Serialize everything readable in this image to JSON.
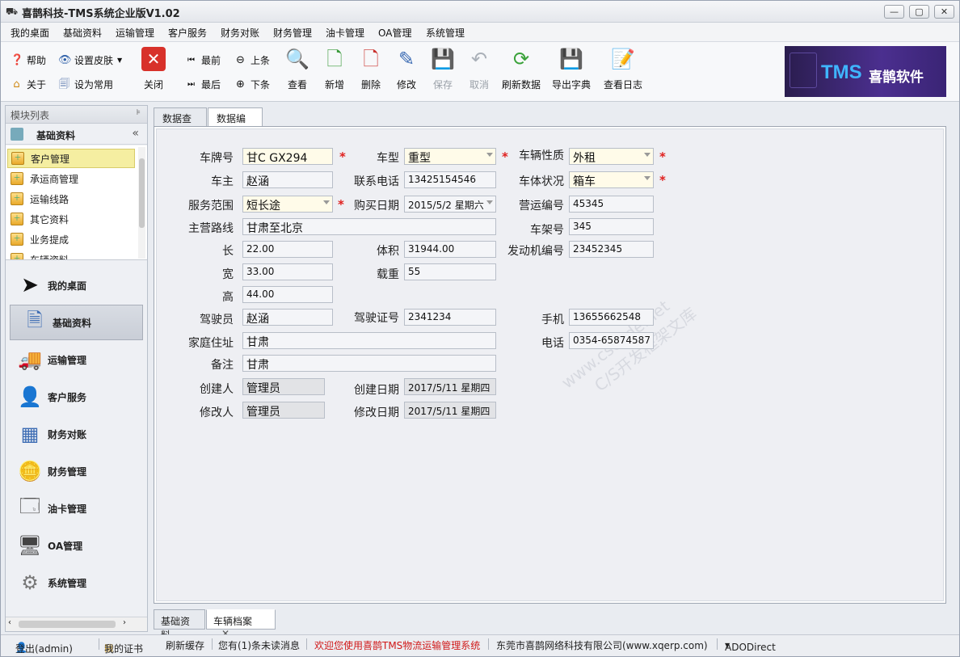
{
  "window": {
    "title": "喜鹊科技-TMS系统企业版V1.02"
  },
  "menu": [
    "我的桌面",
    "基础资料",
    "运输管理",
    "客户服务",
    "财务对账",
    "财务管理",
    "油卡管理",
    "OA管理",
    "系统管理"
  ],
  "toolbar": {
    "help": "帮助",
    "skin": "设置皮肤",
    "about": "关于",
    "set_common": "设为常用",
    "close": "关闭",
    "first": "最前",
    "last": "最后",
    "prev": "上条",
    "next": "下条",
    "view": "查看",
    "add": "新增",
    "delete": "删除",
    "edit": "修改",
    "save": "保存",
    "cancel": "取消",
    "refresh": "刷新数据",
    "export": "导出字典",
    "log": "查看日志"
  },
  "banner": {
    "tms": "TMS",
    "company": "喜鹊软件"
  },
  "sidebar": {
    "header": "模块列表",
    "group": "基础资料",
    "tree": [
      "客户管理",
      "承运商管理",
      "运输线路",
      "其它资料",
      "业务提成",
      "车辆资料"
    ],
    "nav": [
      "我的桌面",
      "基础资料",
      "运输管理",
      "客户服务",
      "财务对账",
      "财务管理",
      "油卡管理",
      "OA管理",
      "系统管理"
    ]
  },
  "tabs": {
    "query": "数据查询",
    "edit": "数据编辑"
  },
  "form": {
    "plate_label": "车牌号",
    "plate": "甘C GX294",
    "type_label": "车型",
    "type": "重型",
    "nature_label": "车辆性质",
    "nature": "外租",
    "owner_label": "车主",
    "owner": "赵涵",
    "phone_label": "联系电话",
    "phone": "13425154546",
    "body_label": "车体状况",
    "body": "箱车",
    "scope_label": "服务范围",
    "scope": "短长途",
    "buy_label": "购买日期",
    "buy": "2015/5/2 星期六",
    "opno_label": "营运编号",
    "opno": "45345",
    "route_label": "主营路线",
    "route": "甘肃至北京",
    "frame_label": "车架号",
    "frame": "345",
    "len_label": "长",
    "len": "22.00",
    "vol_label": "体积",
    "vol": "31944.00",
    "engine_label": "发动机编号",
    "engine": "23452345",
    "wid_label": "宽",
    "wid": "33.00",
    "load_label": "载重",
    "load": "55",
    "hei_label": "高",
    "hei": "44.00",
    "driver_label": "驾驶员",
    "driver": "赵涵",
    "license_label": "驾驶证号",
    "license": "2341234",
    "mobile_label": "手机",
    "mobile": "13655662548",
    "address_label": "家庭住址",
    "address": "甘肃",
    "tel_label": "电话",
    "tel": "0354-65874587",
    "note_label": "备注",
    "note": "甘肃",
    "creator_label": "创建人",
    "creator": "管理员",
    "cdate_label": "创建日期",
    "cdate": "2017/5/11 星期四",
    "modifier_label": "修改人",
    "modifier": "管理员",
    "mdate_label": "修改日期",
    "mdate": "2017/5/11 星期四"
  },
  "watermark": {
    "line1": "www.cscode.net",
    "line2": "C/S开发框架文库"
  },
  "bottom_tabs": [
    "基础资料",
    "车辆档案"
  ],
  "status": {
    "logout": "登出(admin)",
    "cert": "我的证书",
    "refresh": "刷新缓存",
    "msg": "您有(1)条未读消息",
    "welcome": "欢迎您使用喜鹊TMS物流运输管理系统",
    "company": "东莞市喜鹊网络科技有限公司(www.xqerp.com)",
    "db": "ADODirect"
  },
  "colors": {
    "required": "#e0201e",
    "selected_row": "#f5eea1",
    "welcome_text": "#d01818",
    "banner_blue": "#3fb5ff"
  }
}
